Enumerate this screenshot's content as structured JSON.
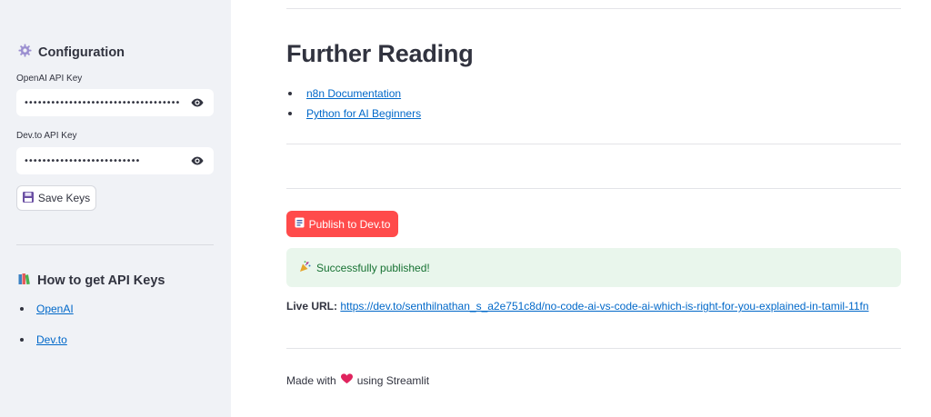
{
  "sidebar": {
    "config_heading": "Configuration",
    "openai_label": "OpenAI API Key",
    "openai_value": "••••••••••••••••••••••••••••••••••••••••••••••••••••",
    "devto_label": "Dev.to API Key",
    "devto_value": "••••••••••••••••••••••••••",
    "save_button": "Save Keys",
    "howto_heading": "How to get API Keys",
    "links": [
      "OpenAI",
      "Dev.to"
    ]
  },
  "main": {
    "title": "Further Reading",
    "reading_links": [
      "n8n Documentation",
      "Python for AI Beginners"
    ],
    "publish_button": "Publish to Dev.to",
    "success_message": "Successfully published!",
    "live_url_label": "Live URL:",
    "live_url": "https://dev.to/senthilnathan_s_a2e751c8d/no-code-ai-vs-code-ai-which-is-right-for-you-explained-in-tamil-11fn",
    "footer_prefix": "Made with",
    "footer_suffix": "using Streamlit"
  },
  "icons": {
    "config": "gear-icon",
    "reveal": "eye-icon",
    "save": "floppy-disk-icon",
    "howto": "books-icon",
    "publish": "document-icon",
    "success": "party-popper-icon",
    "footer": "heart-icon"
  },
  "colors": {
    "sidebar_bg": "#f0f2f6",
    "primary": "#ff4b4b",
    "link": "#0068c9",
    "success_bg": "#e9f6ec",
    "success_text": "#177233",
    "heart": "#e0245e"
  }
}
